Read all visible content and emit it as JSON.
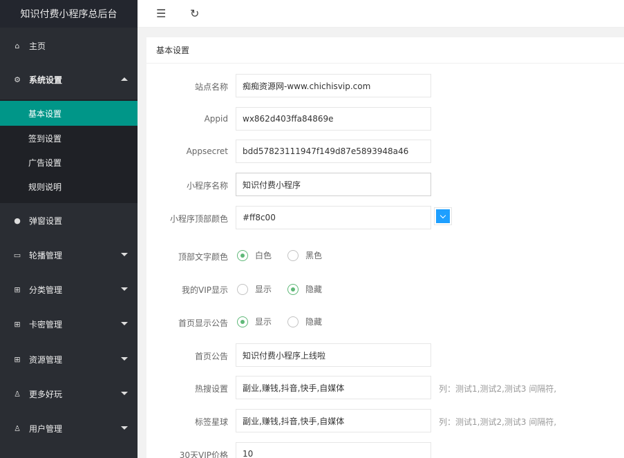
{
  "app": {
    "title": "知识付费小程序总后台"
  },
  "sidebar": {
    "home": {
      "label": "主页",
      "icon": "home-icon"
    },
    "system_settings": {
      "label": "系统设置",
      "icon": "gear-icon",
      "children": [
        {
          "label": "基本设置",
          "active": true
        },
        {
          "label": "签到设置"
        },
        {
          "label": "广告设置"
        },
        {
          "label": "规则说明"
        }
      ]
    },
    "items": [
      {
        "label": "弹窗设置",
        "icon": "dot-icon"
      },
      {
        "label": "轮播管理",
        "icon": "image-icon"
      },
      {
        "label": "分类管理",
        "icon": "apps-icon"
      },
      {
        "label": "卡密管理",
        "icon": "apps-icon"
      },
      {
        "label": "资源管理",
        "icon": "apps-icon"
      },
      {
        "label": "更多好玩",
        "icon": "user-icon"
      },
      {
        "label": "用户管理",
        "icon": "user-icon"
      }
    ]
  },
  "header": {
    "menu_icon": "menu-fold-icon",
    "refresh_icon": "refresh-icon"
  },
  "card": {
    "title": "基本设置"
  },
  "form": {
    "site_name": {
      "label": "站点名称",
      "value": "痴痴资源网-www.chichisvip.com"
    },
    "appid": {
      "label": "Appid",
      "value": "wx862d403ffa84869e"
    },
    "appsecret": {
      "label": "Appsecret",
      "value": "bdd57823111947f149d87e5893948a46"
    },
    "mini_name": {
      "label": "小程序名称",
      "value": "知识付费小程序"
    },
    "top_color": {
      "label": "小程序顶部颜色",
      "value": "#ff8c00",
      "picker_color": "#1e9fff"
    },
    "top_text_color": {
      "label": "顶部文字颜色",
      "options": [
        "白色",
        "黑色"
      ],
      "selected": "白色"
    },
    "my_vip": {
      "label": "我的VIP显示",
      "options": [
        "显示",
        "隐藏"
      ],
      "selected": "隐藏"
    },
    "home_notice_show": {
      "label": "首页显示公告",
      "options": [
        "显示",
        "隐藏"
      ],
      "selected": "显示"
    },
    "home_notice": {
      "label": "首页公告",
      "value": "知识付费小程序上线啦"
    },
    "hot_search": {
      "label": "热搜设置",
      "value": "副业,赚钱,抖音,快手,自媒体",
      "tip": "列：测试1,测试2,测试3 间隔符,"
    },
    "tag_planet": {
      "label": "标签星球",
      "value": "副业,赚钱,抖音,快手,自媒体",
      "tip": "列：测试1,测试2,测试3 间隔符,"
    },
    "vip30": {
      "label": "30天VIP价格",
      "value": "10"
    }
  },
  "colors": {
    "sidebar_bg": "#2a2d33",
    "active_green": "#009688",
    "radio_green": "#5fb878"
  }
}
